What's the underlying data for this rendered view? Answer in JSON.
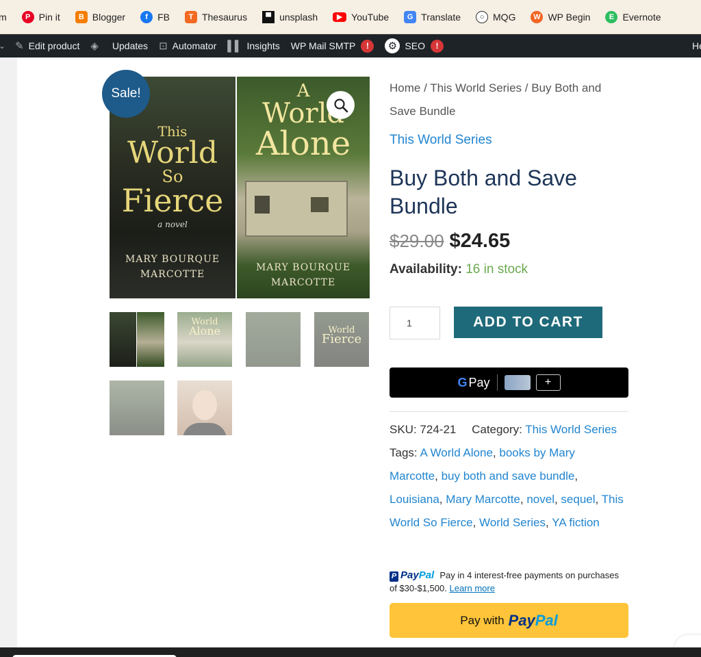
{
  "bookmarks": [
    {
      "label": "m",
      "icon": "generic-icon",
      "color": "#888888"
    },
    {
      "label": "Pin it",
      "icon": "pinterest-icon",
      "color": "#e60023"
    },
    {
      "label": "Blogger",
      "icon": "blogger-icon",
      "color": "#f57d00"
    },
    {
      "label": "FB",
      "icon": "facebook-icon",
      "color": "#1877f2"
    },
    {
      "label": "Thesaurus",
      "icon": "thesaurus-icon",
      "color": "#f26a21"
    },
    {
      "label": "unsplash",
      "icon": "unsplash-icon",
      "color": "#111111"
    },
    {
      "label": "YouTube",
      "icon": "youtube-icon",
      "color": "#ff0000"
    },
    {
      "label": "Translate",
      "icon": "translate-icon",
      "color": "#4285f4"
    },
    {
      "label": "MQG",
      "icon": "globe-icon",
      "color": "#333333"
    },
    {
      "label": "WP Begin",
      "icon": "wpbeginner-icon",
      "color": "#f26522"
    },
    {
      "label": "Evernote",
      "icon": "evernote-icon",
      "color": "#2dbe60"
    }
  ],
  "adminbar": {
    "edit_product": "Edit product",
    "updates": "Updates",
    "automator": "Automator",
    "insights": "Insights",
    "wp_mail_smtp": "WP Mail SMTP",
    "wp_mail_badge": "!",
    "seo": "SEO",
    "seo_badge": "!",
    "right_truncated": "He"
  },
  "gallery": {
    "sale_badge": "Sale!",
    "cover_a": {
      "title_1": "This",
      "title_2": "World",
      "title_3": "So",
      "title_4": "Fierce",
      "subtitle": "a novel",
      "author_1": "Mary Bourque",
      "author_2": "Marcotte"
    },
    "cover_b": {
      "title_1": "A",
      "title_2": "World",
      "title_3": "Alone",
      "author_1": "Mary Bourque",
      "author_2": "Marcotte"
    },
    "thumb_1": {
      "t1": "World",
      "t2": "Alone"
    },
    "thumb_3": {
      "t1": "World",
      "t2": "Fierce"
    }
  },
  "product": {
    "breadcrumb": "Home / This World Series / Buy Both and Save Bundle",
    "category_link": "This World Series",
    "title": "Buy Both and Save Bundle",
    "old_price": "$29.00",
    "new_price": "$24.65",
    "availability_label": "Availability:",
    "stock": "16 in stock",
    "quantity": "1",
    "add_to_cart": "ADD TO CART",
    "gpay_g": "G",
    "gpay_label": "Pay",
    "gpay_plus": "+"
  },
  "meta": {
    "sku_label": "SKU:",
    "sku": "724-21",
    "category_label": "Category:",
    "category": "This World Series",
    "tags_label": "Tags:",
    "tags": [
      "A World Alone",
      "books by Mary Marcotte",
      "buy both and save bundle",
      "Louisiana",
      "Mary Marcotte",
      "novel",
      "sequel",
      "This World So Fierce",
      "World Series",
      "YA fiction"
    ]
  },
  "paypal": {
    "logo_pay": "Pay",
    "logo_pal": "Pal",
    "message": "Pay in 4 interest-free payments on purchases of $30-$1,500.",
    "learn_more": "Learn more",
    "button_prefix": "Pay with"
  }
}
